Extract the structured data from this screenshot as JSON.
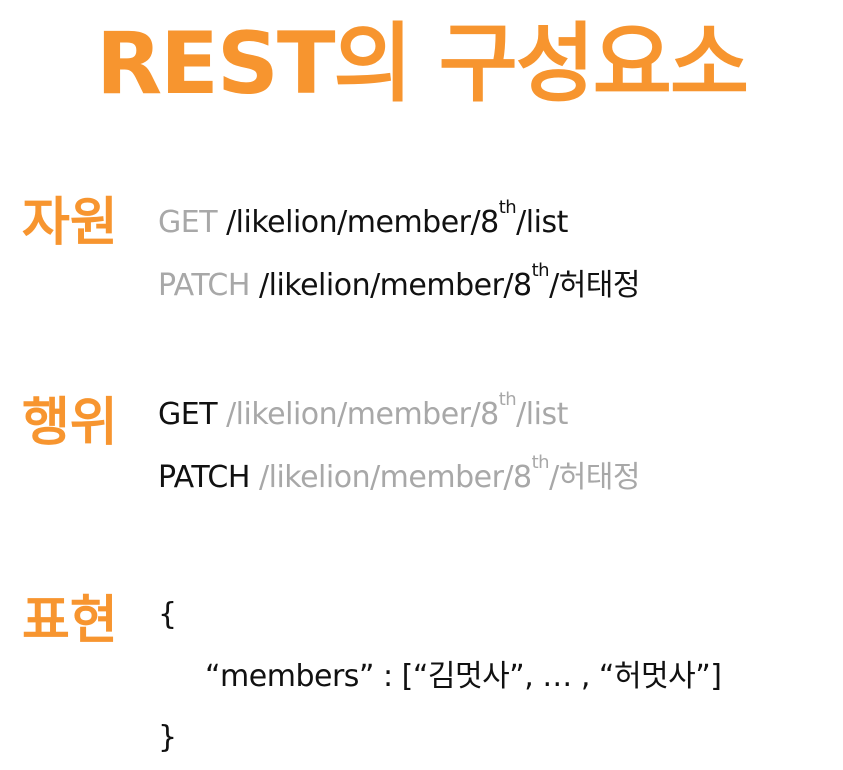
{
  "colors": {
    "accent": "#f7952f",
    "text": "#111111",
    "muted": "#a8a8a8"
  },
  "title": "REST의 구성요소",
  "sections": {
    "resource": {
      "label": "자원",
      "lines": [
        {
          "method": "GET",
          "path_a": "/likelion/member/8",
          "sup": "th",
          "path_b": "/list"
        },
        {
          "method": "PATCH",
          "path_a": "/likelion/member/8",
          "sup": "th",
          "path_b": "/허태정"
        }
      ]
    },
    "verb": {
      "label": "행위",
      "lines": [
        {
          "method": "GET",
          "path_a": "/likelion/member/8",
          "sup": "th",
          "path_b": "/list"
        },
        {
          "method": "PATCH",
          "path_a": "/likelion/member/8",
          "sup": "th",
          "path_b": "/허태정"
        }
      ]
    },
    "representation": {
      "label": "표현",
      "open_brace": "{",
      "body": "“members” : [“김멋사”, … , “허멋사”]",
      "close_brace": "}"
    }
  }
}
